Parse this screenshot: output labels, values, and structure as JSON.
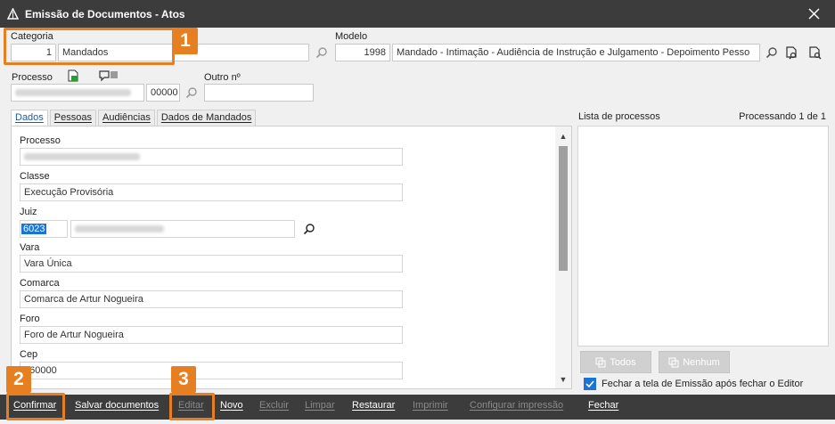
{
  "window": {
    "title": "Emissão de Documentos - Atos",
    "app_icon": "triangle-logo-icon",
    "close_icon": "close-icon"
  },
  "top": {
    "categoria_label": "Categoria",
    "categoria_code": "1",
    "categoria_value": "Mandados",
    "modelo_label": "Modelo",
    "modelo_code": "1998",
    "modelo_value": "Mandado - Intimação - Audiência de Instrução e Julgamento - Depoimento Pesso",
    "processo_label": "Processo",
    "processo_suffix": "00000",
    "outro_label": "Outro nº"
  },
  "annotations": {
    "badge1": "1",
    "badge2": "2",
    "badge3": "3",
    "color": "#e67e22"
  },
  "tabs": [
    {
      "label": "Dados"
    },
    {
      "label": "Pessoas"
    },
    {
      "label": "Audiências"
    },
    {
      "label": "Dados de Mandados"
    }
  ],
  "form": {
    "processo_label": "Processo",
    "classe_label": "Classe",
    "classe_value": "Execução Provisória",
    "juiz_label": "Juiz",
    "juiz_code": "6023",
    "vara_label": "Vara",
    "vara_value": "Vara Única",
    "comarca_label": "Comarca",
    "comarca_value": "Comarca de Artur Nogueira",
    "foro_label": "Foro",
    "foro_value": "Foro de Artur Nogueira",
    "cep_label": "Cep",
    "cep_value": "160000"
  },
  "list": {
    "label": "Lista de processos",
    "status": "Processando 1 de 1",
    "todos_label": "Todos",
    "nenhum_label": "Nenhum",
    "checkbox_label": "Fechar a tela de Emissão após fechar o Editor",
    "checked": true
  },
  "bottom": {
    "confirmar": "Confirmar",
    "salvar": "Salvar documentos",
    "editar": "Editar",
    "novo": "Novo",
    "excluir": "Excluir",
    "limpar": "Limpar",
    "restaurar": "Restaurar",
    "imprimir": "Imprimir",
    "configurar": "Configurar impressão",
    "fechar": "Fechar"
  },
  "colors": {
    "titlebar": "#3c3c3c",
    "accent": "#1b74d4",
    "highlight": "#e67e22"
  }
}
